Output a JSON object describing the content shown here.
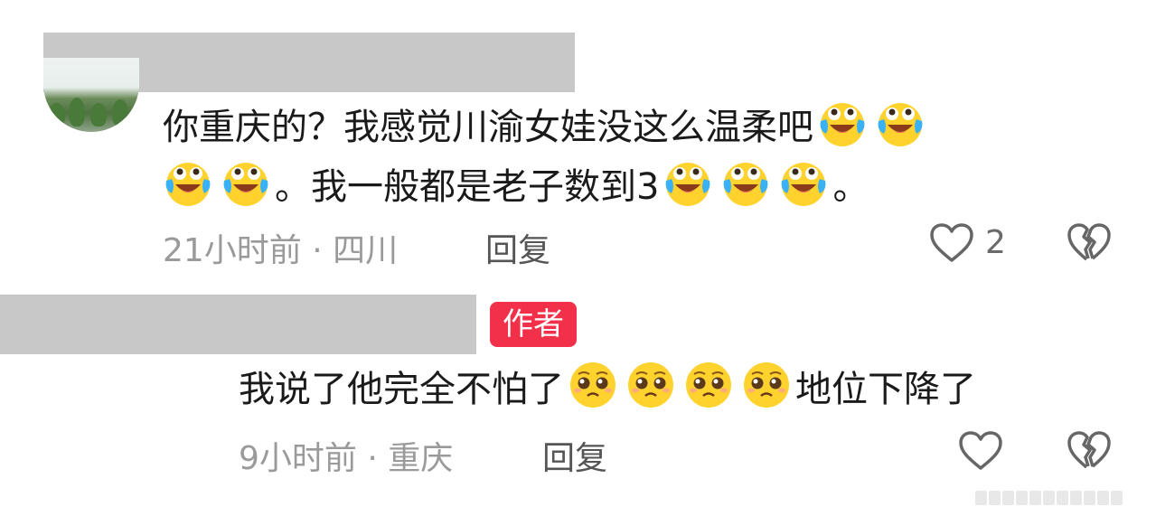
{
  "comments": [
    {
      "line1": "你重庆的？我感觉川渝女娃没这么温柔吧",
      "line2_prefix": "。我一般都是老子数到3",
      "line2_suffix": "。",
      "time_location": "21小时前 · 四川",
      "reply_label": "回复",
      "like_count": "2",
      "emoji": "crying-laughing"
    },
    {
      "author_badge": "作者",
      "text_prefix": "我说了他完全不怕了",
      "text_suffix": "地位下降了",
      "time_location": "9小时前 · 重庆",
      "reply_label": "回复",
      "emoji": "pleading"
    }
  ],
  "colors": {
    "badge": "#f2304a",
    "meta": "#9a9a9a",
    "emoji_face": "#ffd22e",
    "tears": "#3ab0f5"
  }
}
